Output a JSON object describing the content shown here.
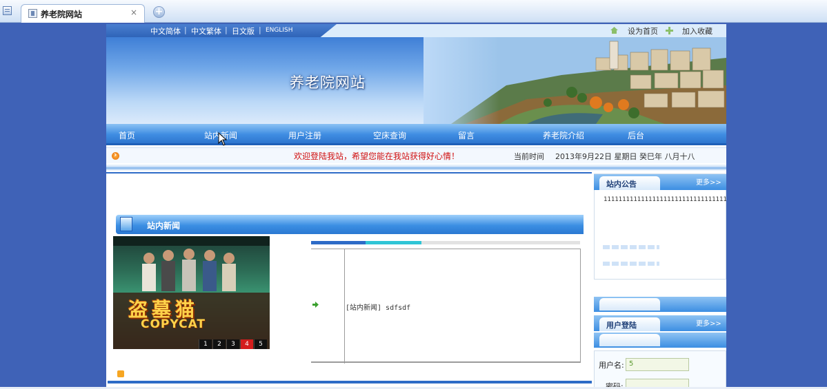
{
  "browser": {
    "tab_title": "养老院网站",
    "close_glyph": "×",
    "new_tab_glyph": "+"
  },
  "topbar": {
    "languages": [
      "中文简体",
      "中文繁体",
      "日文版",
      "ENGLISH"
    ],
    "separator": "|",
    "set_home": "设为首页",
    "add_favorite": "加入收藏"
  },
  "banner": {
    "site_title": "养老院网站"
  },
  "nav": {
    "items": [
      "首页",
      "站内新闻",
      "用户注册",
      "空床查询",
      "留言",
      "养老院介绍",
      "后台"
    ]
  },
  "welcome": {
    "message": "欢迎登陆我站，希望您能在我站获得好心情！",
    "time_label": "当前时间",
    "time_value": "2013年9月22日  星期日  癸巳年  八月十八"
  },
  "news": {
    "title": "站内新闻",
    "poster_title": "盗墓猫",
    "poster_subtitle": "COPYCAT",
    "poster_pages": [
      "1",
      "2",
      "3",
      "4",
      "5"
    ],
    "poster_active_page": "4",
    "items": [
      "[站内新闻] sdfsdf"
    ]
  },
  "sidebar": {
    "notice_title": "站内公告",
    "notice_more": "更多>>",
    "notice_text": "11111111111111111111111111111111111",
    "login_title": "用户登陆",
    "login_more": "更多>>",
    "username_label": "用户名:",
    "username_value": "5",
    "password_label": "密码:"
  },
  "colors": {
    "body_background": "#3f62b7",
    "nav_blue": "#3f8de2",
    "welcome_red": "#d01010",
    "accent_orange": "#f6a623"
  }
}
